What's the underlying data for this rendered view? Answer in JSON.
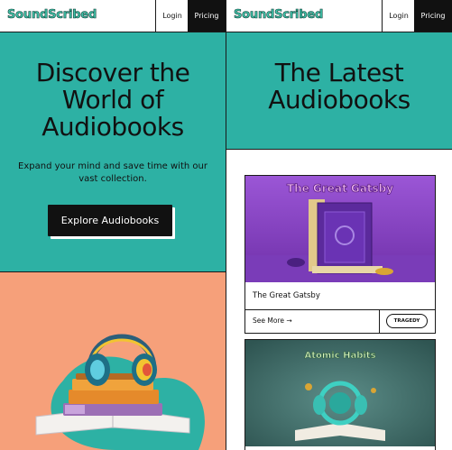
{
  "brand": {
    "logo_text": "SoundScribed"
  },
  "nav": {
    "login_label": "Login",
    "pricing_label": "Pricing"
  },
  "hero": {
    "title_line1": "Discover the",
    "title_line2": "World of",
    "title_line3": "Audiobooks",
    "subtitle_line1": "Expand your mind and save time with our",
    "subtitle_line2": "vast collection.",
    "cta_label": "Explore Audiobooks"
  },
  "latest": {
    "title_line1": "The Latest",
    "title_line2": "Audiobooks"
  },
  "books": [
    {
      "cover_title": "The Great Gatsby",
      "title": "The Great Gatsby",
      "see_more": "See More →",
      "tag": "TRAGEDY"
    },
    {
      "cover_title": "Atomic Habits"
    }
  ],
  "colors": {
    "teal": "#2db1a4",
    "peach": "#f6a07a",
    "black": "#111111",
    "logo": "#3fc1a8"
  }
}
